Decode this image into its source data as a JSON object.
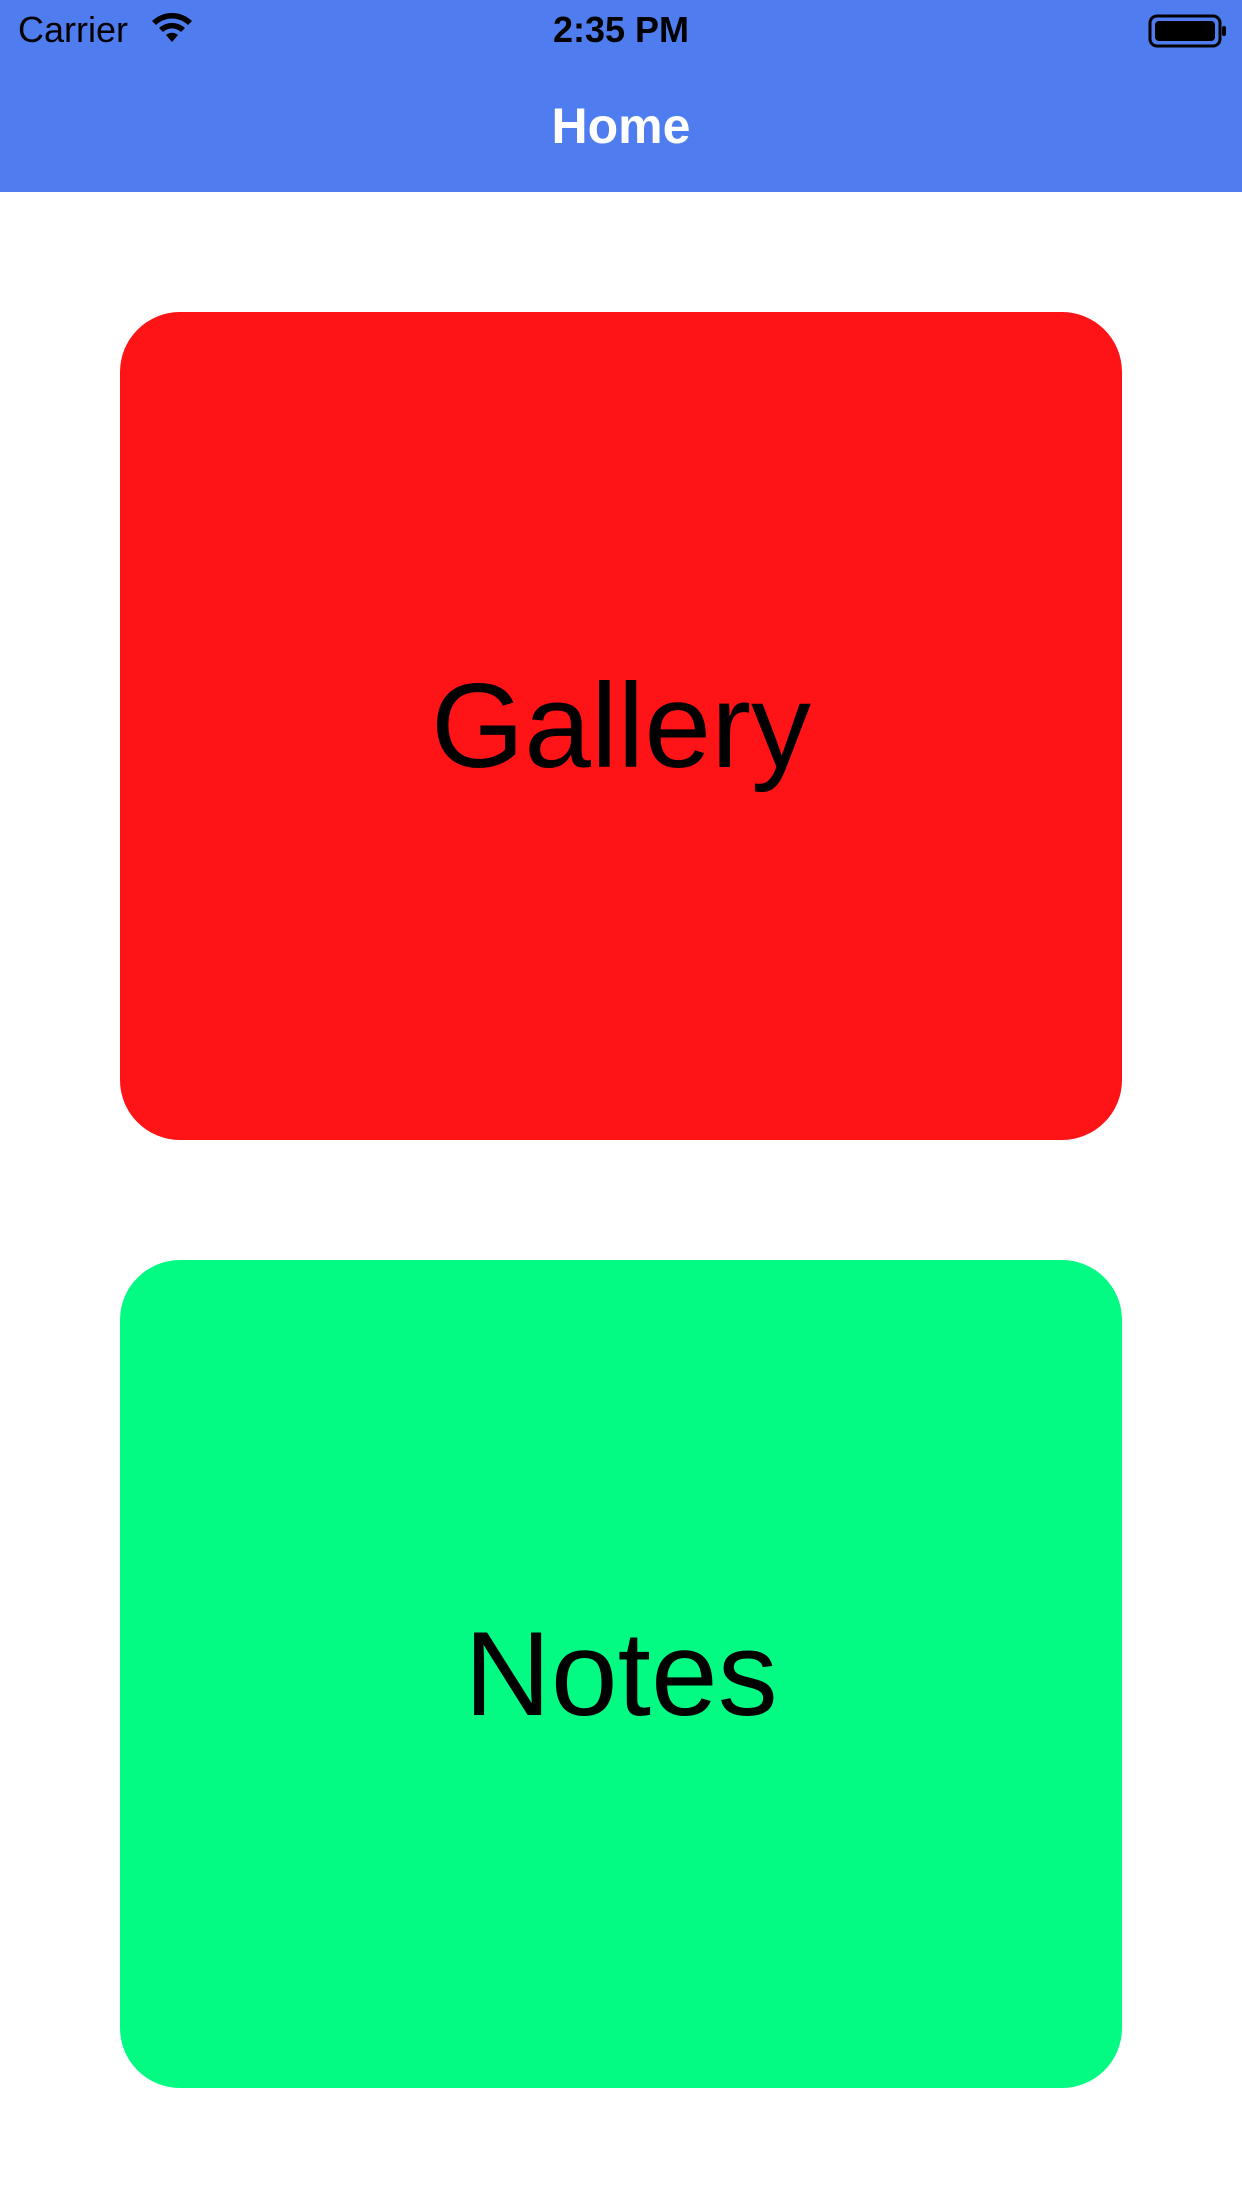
{
  "status_bar": {
    "carrier": "Carrier",
    "time": "2:35 PM",
    "wifi_icon": "wifi-icon",
    "battery_icon": "battery-icon"
  },
  "nav": {
    "title": "Home",
    "background_color": "#4f7def"
  },
  "tiles": [
    {
      "label": "Gallery",
      "color": "#fe1317"
    },
    {
      "label": "Notes",
      "color": "#03fb83"
    }
  ]
}
